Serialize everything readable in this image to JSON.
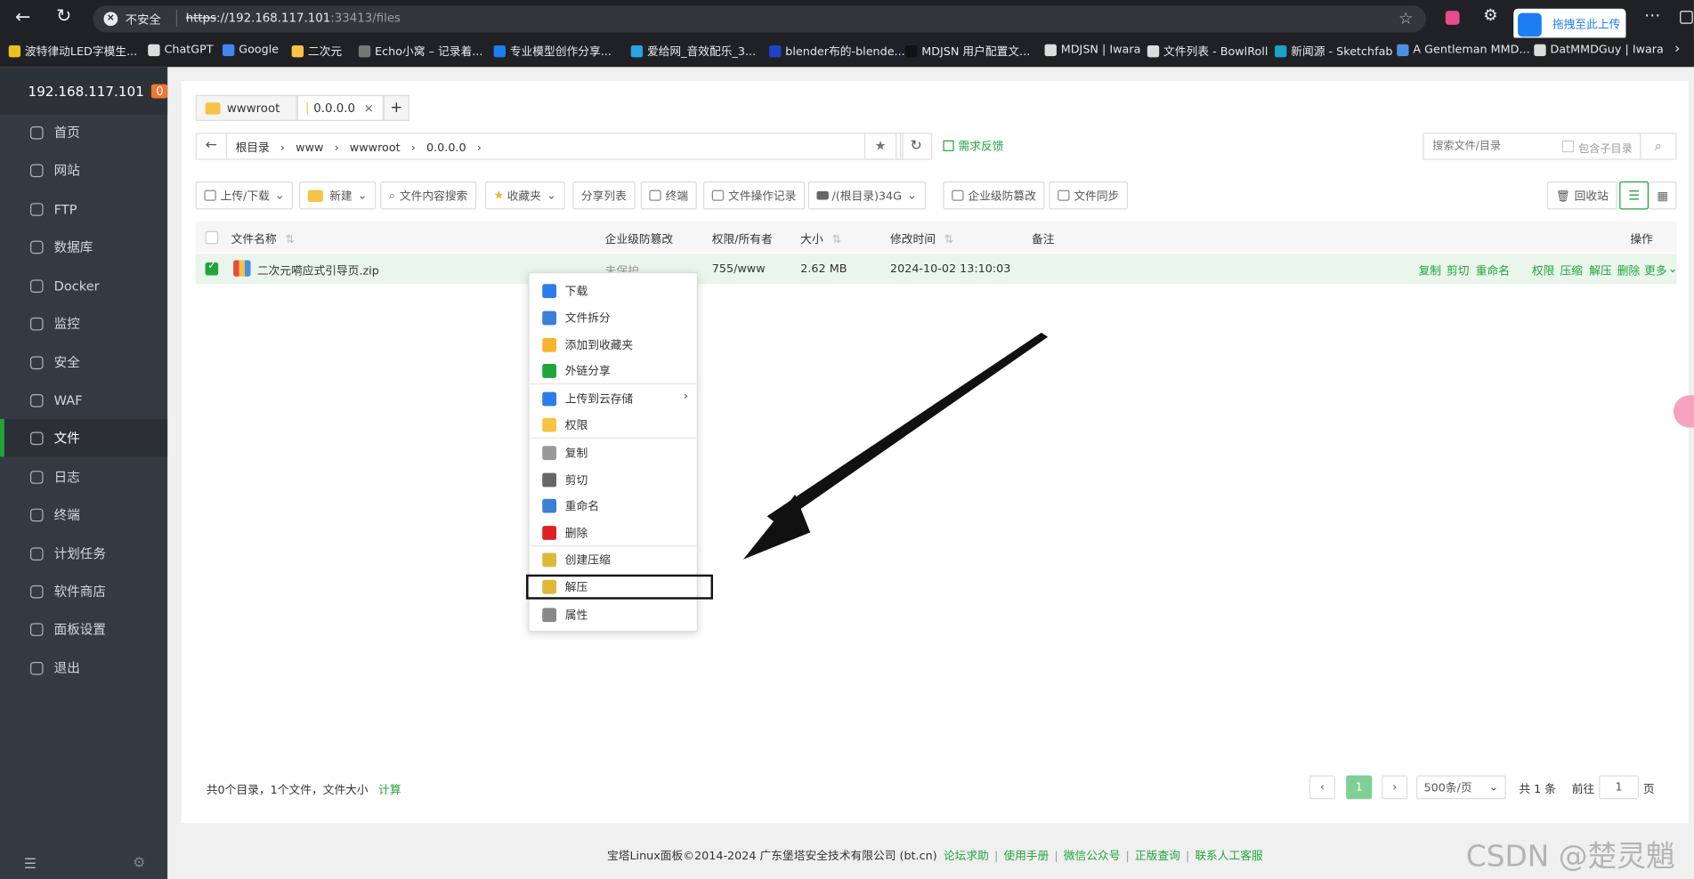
{
  "browser": {
    "not_secure": "不安全",
    "url_scheme": "https",
    "url_rest": "://192.168.117.101",
    "url_port_path": ":33413/files",
    "upload_ext": "拖拽至此上传",
    "bookmarks": [
      "波特律动LED字模生...",
      "ChatGPT",
      "Google",
      "二次元",
      "Echo小窝 – 记录着...",
      "专业模型创作分享...",
      "爱给网_音效配乐_3...",
      "blender布的-blende...",
      "MDJSN 用户配置文...",
      "MDJSN | Iwara",
      "文件列表 - BowlRoll",
      "新闻源 - Sketchfab",
      "A Gentleman MMD...",
      "DatMMDGuy | Iwara"
    ]
  },
  "sidebar": {
    "host": "192.168.117.101",
    "badge": "0",
    "items": [
      "首页",
      "网站",
      "FTP",
      "数据库",
      "Docker",
      "监控",
      "安全",
      "WAF",
      "文件",
      "日志",
      "终端",
      "计划任务",
      "软件商店",
      "面板设置",
      "退出"
    ],
    "active_index": 8
  },
  "tabs": [
    "wwwroot",
    "0.0.0.0"
  ],
  "breadcrumb": [
    "根目录",
    "www",
    "wwwroot",
    "0.0.0.0"
  ],
  "feedback": "需求反馈",
  "search": {
    "placeholder": "搜索文件/目录",
    "subdir": "包含子目录"
  },
  "toolbar": {
    "upload": "上传/下载",
    "new": "新建",
    "content_search": "文件内容搜索",
    "favorites": "收藏夹",
    "share_list": "分享列表",
    "terminal": "终端",
    "op_log": "文件操作记录",
    "disk": "/(根目录)34G",
    "tamper": "企业级防篡改",
    "sync": "文件同步",
    "recycle": "回收站"
  },
  "table": {
    "headers": [
      "文件名称",
      "企业级防篡改",
      "权限/所有者",
      "大小",
      "修改时间",
      "备注",
      "操作"
    ],
    "rows": [
      {
        "name": "二次元嗬应式引导页.zip",
        "tamper": "未保护",
        "perm": "755/www",
        "size": "2.62 MB",
        "mtime": "2024-10-02 13:10:03",
        "note": ""
      }
    ],
    "row_ops": [
      "复制",
      "剪切",
      "重命名",
      "权限",
      "压缩",
      "解压",
      "删除",
      "更多"
    ]
  },
  "context_menu": {
    "items": [
      "下载",
      "文件拆分",
      "添加到收藏夹",
      "外链分享",
      "上传到云存储",
      "权限",
      "复制",
      "剪切",
      "重命名",
      "删除",
      "创建压缩",
      "解压",
      "属性"
    ],
    "highlighted": "解压"
  },
  "summary": {
    "text": "共0个目录，1个文件，文件大小",
    "calc": "计算"
  },
  "pagination": {
    "current": "1",
    "per_page": "500条/页",
    "total": "共 1 条",
    "goto_label": "前往",
    "goto_value": "1",
    "page_unit": "页"
  },
  "footer": {
    "copyright": "宝塔Linux面板©2014-2024 广东堡塔安全技术有限公司 (bt.cn)",
    "links": [
      "论坛求助",
      "使用手册",
      "微信公众号",
      "正版查询",
      "联系人工客服"
    ]
  },
  "watermark": "CSDN @楚灵魈",
  "colors": {
    "accent": "#20a53a",
    "sidebar": "#333a42",
    "menu_danger": "#e02020"
  }
}
